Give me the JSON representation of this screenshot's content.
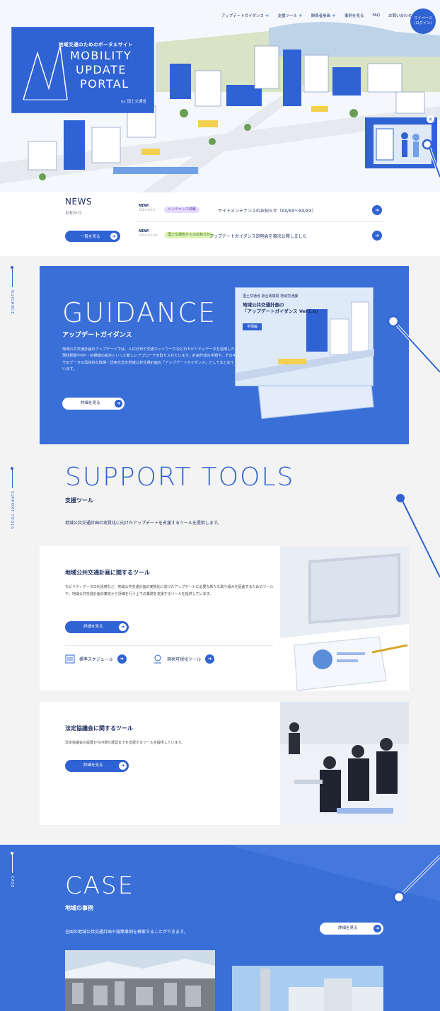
{
  "colors": {
    "brand": "#2f62d3",
    "section_blue": "#3a6fd8",
    "bg": "#f3f3f3"
  },
  "logo": {
    "tagline": "地域交通のためのポータルサイト",
    "line1": "MOBILITY",
    "line2": "UPDATE",
    "line3": "PORTAL",
    "org": "by 国土交通省"
  },
  "nav": {
    "items": [
      {
        "label": "アップデートガイダンス",
        "plus": "+"
      },
      {
        "label": "支援ツール",
        "plus": "+"
      },
      {
        "label": "関係者参画",
        "plus": "+"
      },
      {
        "label": "事例を見る",
        "plus": ""
      },
      {
        "label": "FAQ",
        "plus": ""
      },
      {
        "label": "お問い合わせ",
        "plus": ""
      }
    ],
    "mypage_line1": "マイページ",
    "mypage_line2": "（ログイン）"
  },
  "hero_banner": {
    "close_icon": "×"
  },
  "news": {
    "title": "NEWS",
    "subtitle": "お知らせ",
    "more_label": "一覧を見る",
    "rows": [
      {
        "new": "NEW!",
        "date": "2024.XX.X",
        "tag": "メンテナンス情報",
        "text": "サイトメンテナンスのお知らせ（XX/XX〜XX/XX）"
      },
      {
        "new": "NEW!",
        "date": "2024.XX.XX",
        "tag": "国土交通省からのお知らせ",
        "text": "アップデートガイダンス説明会を順次公開しました"
      }
    ]
  },
  "side_labels": {
    "guidance": "GUIDANCE",
    "support": "SUPPORT TOOLS",
    "case": "CASE"
  },
  "guidance": {
    "title": "GUIDANCE",
    "subtitle": "アップデートガイダンス",
    "description": "地域公共交通計画のアップデートでは、人口分布や交通ネットワークなどのモビリティデータを活用した現状把握やKPI・目標値の設定といった新しいアプローチを取り入れています。計画作成の手順や、その中でのデータの具体的な取得・活用方法を地域公共交通計画の「アップデートガイダンス」としてまとめています。",
    "button": "詳細を見る",
    "book_header": "国土交通省 総合政策局 地域交通課",
    "book_title_1": "地域公共交通計画の",
    "book_title_2": "「アップデートガイダンス Ver1.0」",
    "book_badge": "手順編"
  },
  "support": {
    "title": "SUPPORT TOOLS",
    "subtitle": "支援ツール",
    "description": "地域公共交通計画の実質化に向けたアップデートを支援するツールを提供します。",
    "card1": {
      "title": "地域公共交通計画に関するツール",
      "description": "モビリティデータの利活用など、地域公共交通計画の実質化に向けたアップデートに必要な新たな取り組みを促進するためのツールや、地域公共交通計画の策定から評価を行う上での業務を支援するツールを提供しています。",
      "button": "詳細を見る",
      "link1": "標準スケジュール",
      "link2": "現状可視化ツール"
    },
    "card2": {
      "title": "法定協議会に関するツール",
      "description": "法定協議会の設置から円滑な運営までを支援するツールを提供しています。",
      "button": "詳細を見る"
    }
  },
  "case": {
    "title": "CASE",
    "subtitle": "地域の事例",
    "description": "全国の地域公共交通計画や施策事例を検索することができます。",
    "button": "詳細を見る"
  }
}
